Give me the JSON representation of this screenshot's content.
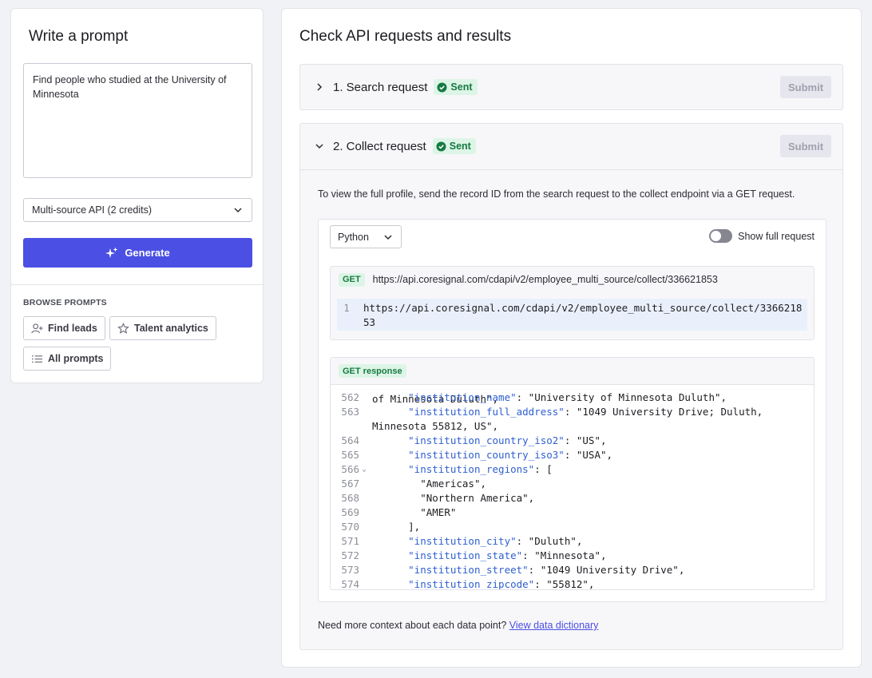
{
  "left": {
    "title": "Write a prompt",
    "prompt_text": "Find people who studied at the University of Minnesota",
    "source_select": "Multi-source API (2 credits)",
    "generate_label": "Generate",
    "browse_label": "BROWSE PROMPTS",
    "chips": [
      "Find leads",
      "Talent analytics",
      "All prompts"
    ]
  },
  "right": {
    "title": "Check API requests and results",
    "request1": {
      "title": "1. Search request",
      "status": "Sent",
      "submit": "Submit"
    },
    "request2": {
      "title": "2. Collect request",
      "status": "Sent",
      "submit": "Submit",
      "description": "To view the full profile, send the record ID from the search request to the collect endpoint via a GET request.",
      "language": "Python",
      "toggle_label": "Show full request",
      "method": "GET",
      "url": "https://api.coresignal.com/cdapi/v2/employee_multi_source/collect/336621853",
      "code_line_number": "1",
      "code_text": "https://api.coresignal.com/cdapi/v2/employee_multi_source/collect/336621853",
      "response_label": "GET response",
      "response_partial_top": "of Minnesota Duluth\",",
      "response_lines": [
        {
          "n": "562",
          "indent": "      ",
          "key": "\"institution_name\"",
          "rest": ": \"University of Minnesota Duluth\","
        },
        {
          "n": "563",
          "indent": "      ",
          "key": "\"institution_full_address\"",
          "rest": ": \"1049 University Drive; Duluth,"
        },
        {
          "n": "",
          "indent": "",
          "key": "",
          "rest": "Minnesota 55812, US\","
        },
        {
          "n": "564",
          "indent": "      ",
          "key": "\"institution_country_iso2\"",
          "rest": ": \"US\","
        },
        {
          "n": "565",
          "indent": "      ",
          "key": "\"institution_country_iso3\"",
          "rest": ": \"USA\","
        },
        {
          "n": "566",
          "indent": "      ",
          "key": "\"institution_regions\"",
          "rest": ": [",
          "fold": "⌄"
        },
        {
          "n": "567",
          "indent": "        ",
          "key": "",
          "rest": "\"Americas\","
        },
        {
          "n": "568",
          "indent": "        ",
          "key": "",
          "rest": "\"Northern America\","
        },
        {
          "n": "569",
          "indent": "        ",
          "key": "",
          "rest": "\"AMER\""
        },
        {
          "n": "570",
          "indent": "      ",
          "key": "",
          "rest": "],"
        },
        {
          "n": "571",
          "indent": "      ",
          "key": "\"institution_city\"",
          "rest": ": \"Duluth\","
        },
        {
          "n": "572",
          "indent": "      ",
          "key": "\"institution_state\"",
          "rest": ": \"Minnesota\","
        },
        {
          "n": "573",
          "indent": "      ",
          "key": "\"institution_street\"",
          "rest": ": \"1049 University Drive\","
        },
        {
          "n": "574",
          "indent": "      ",
          "key": "\"institution_zipcode\"",
          "rest": ": \"55812\","
        }
      ]
    },
    "footer_text": "Need more context about each data point?",
    "footer_link": "View data dictionary"
  },
  "colors": {
    "accent": "#4b4fe3",
    "sent_bg": "#ddf5e6",
    "sent_text": "#167a43",
    "json_key": "#2f5fd0"
  },
  "icons": [
    "sparkle-icon",
    "chevron-down-icon",
    "chevron-right-icon",
    "check-circle-icon",
    "add-user-icon",
    "star-icon",
    "list-icon"
  ]
}
